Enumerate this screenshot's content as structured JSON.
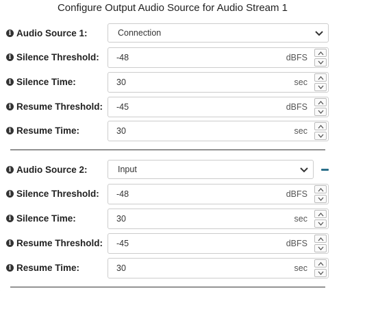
{
  "dialog": {
    "title": "Configure Output Audio Source for Audio Stream 1"
  },
  "stream1": {
    "source_label": "Audio Source 1:",
    "source_value": "Connection",
    "silence_threshold_label": "Silence Threshold:",
    "silence_threshold_value": "-48",
    "silence_threshold_unit": "dBFS",
    "silence_time_label": "Silence Time:",
    "silence_time_value": "30",
    "silence_time_unit": "sec",
    "resume_threshold_label": "Resume Threshold:",
    "resume_threshold_value": "-45",
    "resume_threshold_unit": "dBFS",
    "resume_time_label": "Resume Time:",
    "resume_time_value": "30",
    "resume_time_unit": "sec"
  },
  "stream2": {
    "source_label": "Audio Source 2:",
    "source_value": "Input",
    "silence_threshold_label": "Silence Threshold:",
    "silence_threshold_value": "-48",
    "silence_threshold_unit": "dBFS",
    "silence_time_label": "Silence Time:",
    "silence_time_value": "30",
    "silence_time_unit": "sec",
    "resume_threshold_label": "Resume Threshold:",
    "resume_threshold_value": "-45",
    "resume_threshold_unit": "dBFS",
    "resume_time_label": "Resume Time:",
    "resume_time_value": "30",
    "resume_time_unit": "sec"
  },
  "icons": {
    "info": "info-circle-icon",
    "chevron": "chevron-down-icon",
    "spin_up": "caret-up-icon",
    "spin_down": "caret-down-icon",
    "remove": "minus-icon"
  },
  "colors": {
    "remove_accent": "#2a6f8a",
    "border": "#cccccc"
  }
}
